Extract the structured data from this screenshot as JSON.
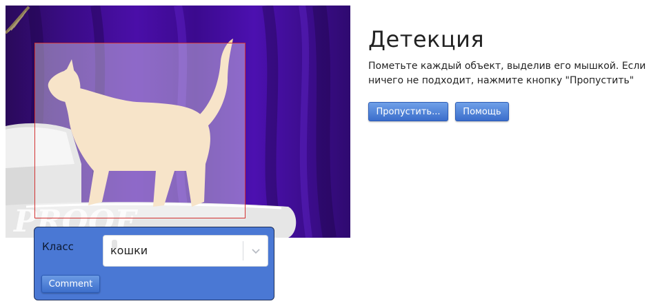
{
  "header": {
    "title": "Детекция",
    "instructions": "Пометьте каждый объект, выделив его мышкой. Если ничего не подходит, нажмите кнопку \"Пропустить\""
  },
  "actions": {
    "skip_label": "Пропустить...",
    "help_label": "Помощь"
  },
  "annotation_popup": {
    "class_label": "Класс",
    "selected_class": "кошки",
    "comment_label": "Comment"
  },
  "image": {
    "watermark": "PROOF"
  },
  "colors": {
    "button_blue": "#4a78d4",
    "bbox_border": "#d33131",
    "backdrop_purple": "#3a0c86"
  }
}
